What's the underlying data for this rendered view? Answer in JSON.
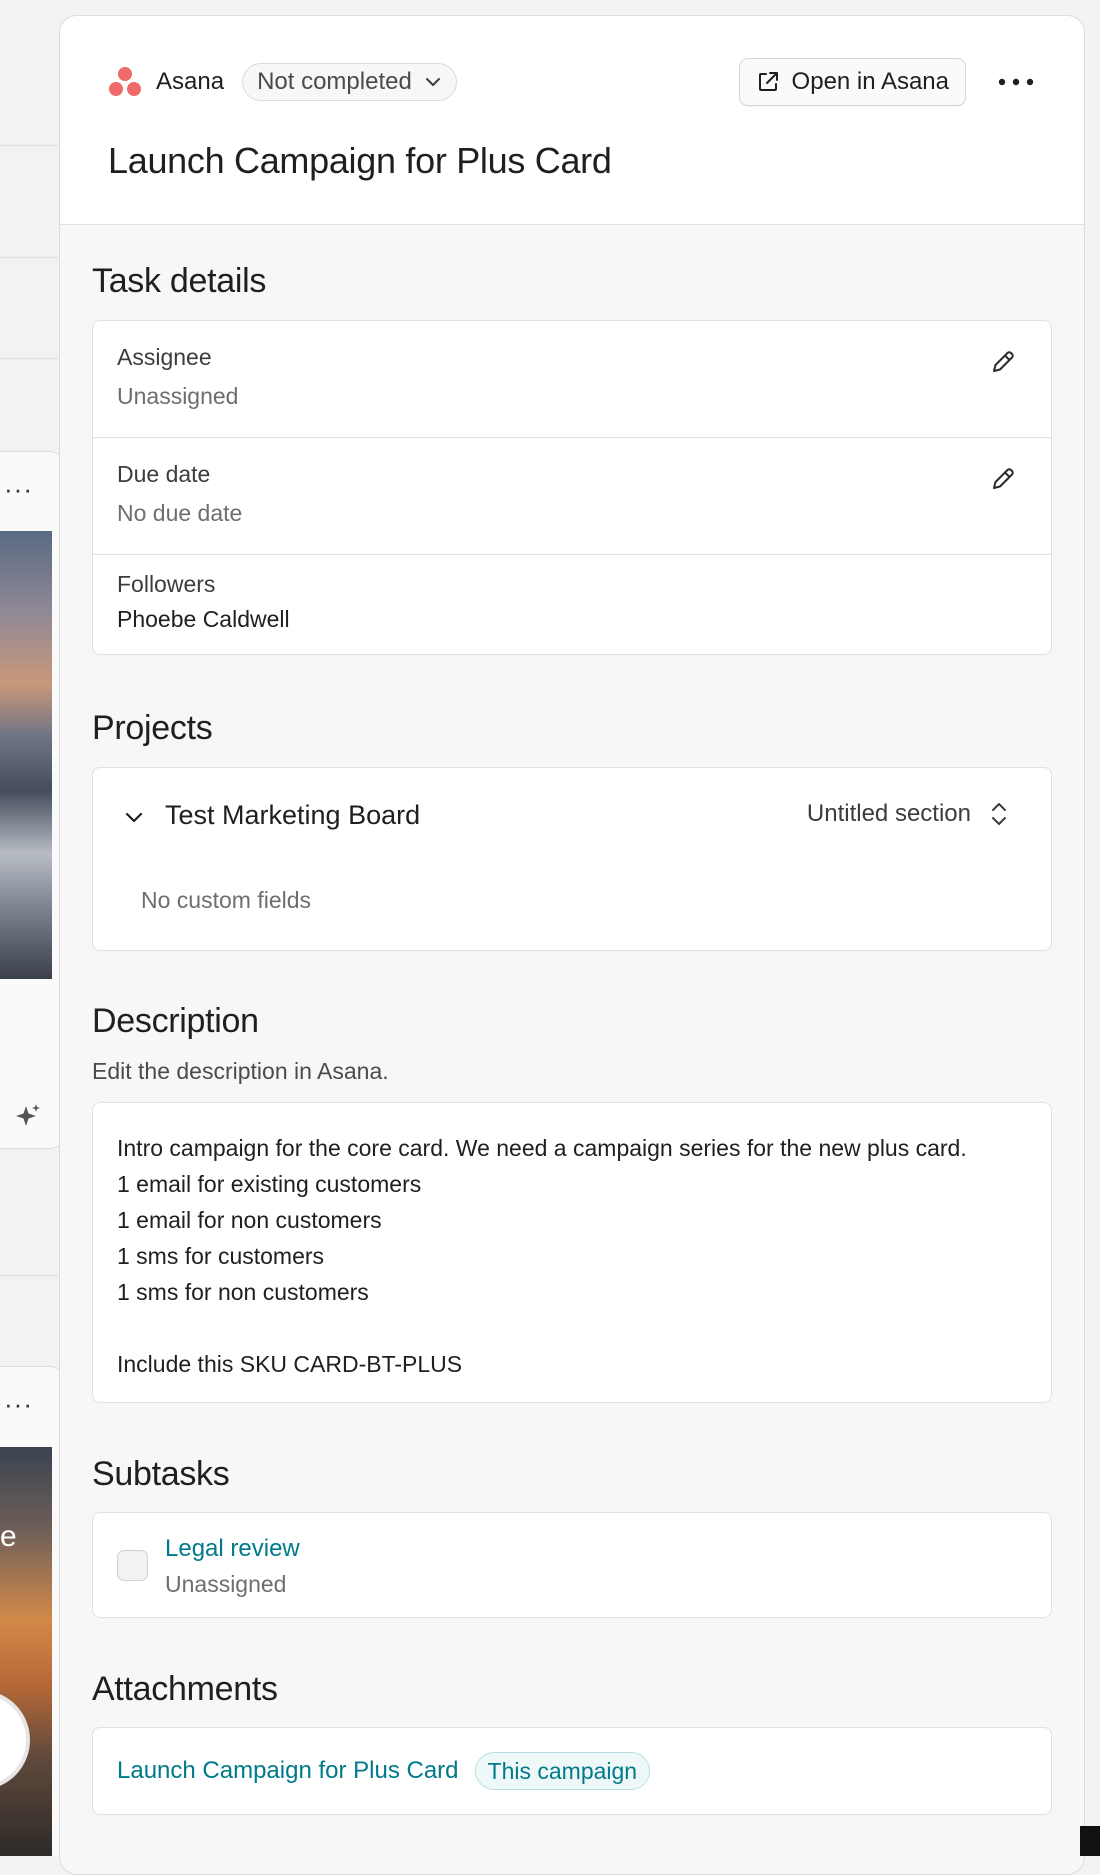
{
  "background": {
    "partial_text": "e"
  },
  "header": {
    "brand": "Asana",
    "status": "Not completed",
    "open_button": "Open in Asana",
    "title": "Launch Campaign for Plus Card"
  },
  "task_details": {
    "heading": "Task details",
    "assignee_label": "Assignee",
    "assignee_value": "Unassigned",
    "due_label": "Due date",
    "due_value": "No due date",
    "followers_label": "Followers",
    "followers_value": "Phoebe Caldwell"
  },
  "projects": {
    "heading": "Projects",
    "project_name": "Test Marketing Board",
    "section": "Untitled section",
    "custom_fields": "No custom fields"
  },
  "description": {
    "heading": "Description",
    "hint": "Edit the description in Asana.",
    "lines": [
      "Intro campaign for the core card. We need a campaign series for the new plus card.",
      "1 email for existing customers",
      "1 email for non customers",
      "1 sms for customers",
      "1 sms for non customers",
      "",
      "Include this SKU CARD-BT-PLUS"
    ]
  },
  "subtasks": {
    "heading": "Subtasks",
    "items": [
      {
        "name": "Legal review",
        "assignee": "Unassigned",
        "completed": false
      }
    ]
  },
  "attachments": {
    "heading": "Attachments",
    "items": [
      {
        "name": "Launch Campaign for Plus Card",
        "badge": "This campaign"
      }
    ]
  },
  "colors": {
    "accent_link": "#007a8a",
    "asana_brand": "#f06a6a",
    "panel_bg": "#f7f7f7"
  },
  "icons": {
    "status_chevron": "chevron-down-icon",
    "open_external": "external-link-icon",
    "more": "more-horizontal-icon",
    "edit": "pencil-icon",
    "project_chevron": "chevron-down-icon",
    "section_select": "chevron-up-down-icon"
  }
}
